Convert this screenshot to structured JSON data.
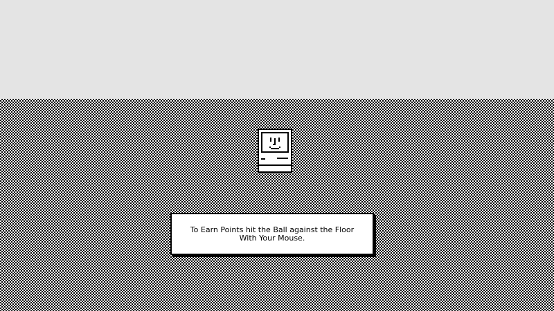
{
  "dialog": {
    "line1": "To Earn Points hit the Ball against the Floor",
    "line2": "With Your Mouse."
  },
  "icons": {
    "computer": "happy-mac-icon"
  },
  "colors": {
    "top_area": "#e4e4e4",
    "pattern_dark": "#000000",
    "pattern_light": "#ffffff",
    "dialog_bg": "#ffffff"
  }
}
